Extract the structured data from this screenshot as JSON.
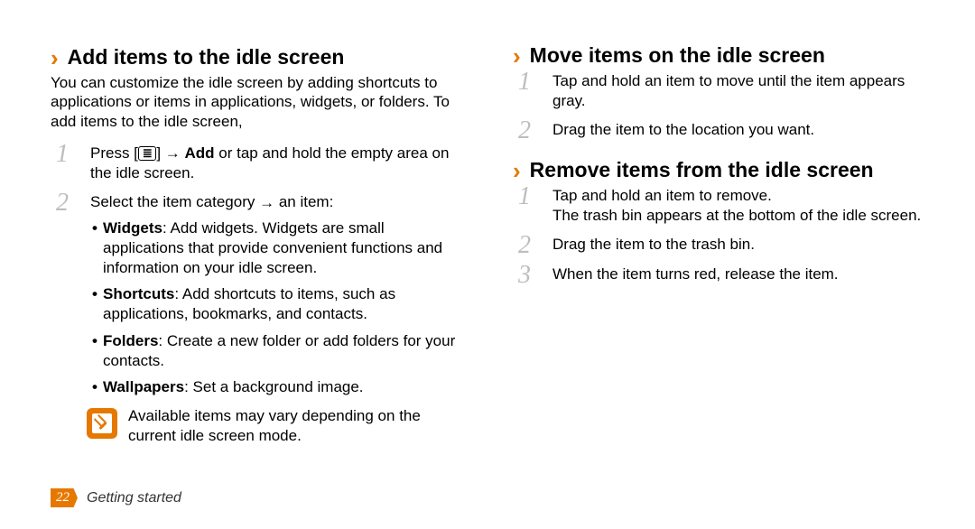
{
  "left": {
    "addHeading": "Add items to the idle screen",
    "intro": "You can customize the idle screen by adding shortcuts to applications or items in applications, widgets, or folders. To add items to the idle screen,",
    "step1Pre": "Press [",
    "step1Post": "] → ",
    "step1Bold": "Add",
    "step1End": " or tap and hold the empty area on the idle screen.",
    "menuGlyph": "≣",
    "step2Pre": "Select the item category ",
    "arrowGlyph": "→",
    "step2Post": " an item:",
    "widgetsLabel": "Widgets",
    "widgetsText": ": Add widgets. Widgets are small applications that provide convenient functions and information on your idle screen.",
    "shortcutsLabel": "Shortcuts",
    "shortcutsText": ": Add shortcuts to items, such as applications, bookmarks, and contacts.",
    "foldersLabel": "Folders",
    "foldersText": ": Create a new folder or add folders for your contacts.",
    "wallpapersLabel": "Wallpapers",
    "wallpapersText": ": Set a background image.",
    "noteText": "Available items may vary depending on the current idle screen mode."
  },
  "right": {
    "moveHeading": "Move items on the idle screen",
    "moveStep1": "Tap and hold an item to move until the item appears gray.",
    "moveStep2": "Drag the item to the location you want.",
    "removeHeading": "Remove items from the idle screen",
    "removeStep1a": "Tap and hold an item to remove.",
    "removeStep1b": "The trash bin appears at the bottom of the idle screen.",
    "removeStep2": "Drag the item to the trash bin.",
    "removeStep3": "When the item turns red, release the item."
  },
  "footer": {
    "pageNumber": "22",
    "chapter": "Getting started"
  }
}
